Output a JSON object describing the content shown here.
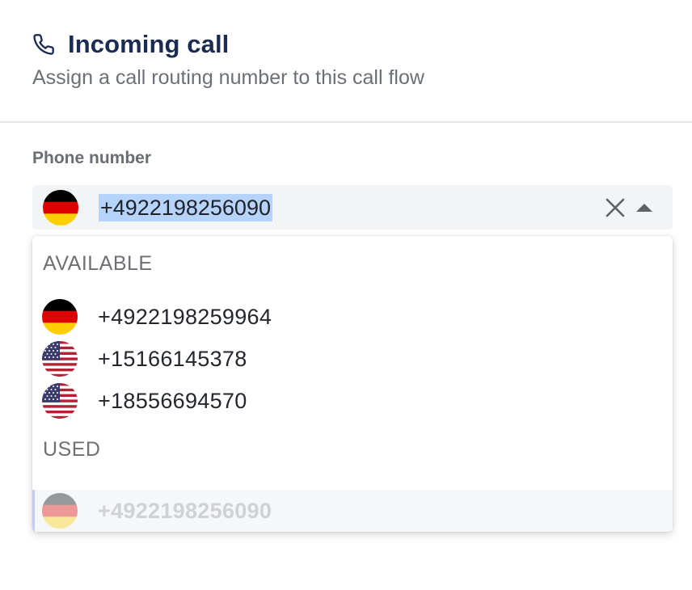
{
  "header": {
    "title": "Incoming call",
    "subtitle": "Assign a call routing number to this call flow",
    "icon": "phone-icon"
  },
  "field": {
    "label": "Phone number",
    "value": "+4922198256090",
    "country": "de",
    "selected": true
  },
  "dropdown": {
    "groups": [
      {
        "label": "AVAILABLE",
        "options": [
          {
            "label": "+4922198259964",
            "country": "de",
            "disabled": false
          },
          {
            "label": "+15166145378",
            "country": "us",
            "disabled": false
          },
          {
            "label": "+18556694570",
            "country": "us",
            "disabled": false
          }
        ]
      },
      {
        "label": "USED",
        "options": [
          {
            "label": "+4922198256090",
            "country": "de",
            "disabled": true
          }
        ]
      }
    ]
  },
  "colors": {
    "title": "#1b2b52",
    "selection": "#b6d4fb",
    "field_bg": "#f3f4f6",
    "disabled_accent": "#c6cbf0"
  }
}
